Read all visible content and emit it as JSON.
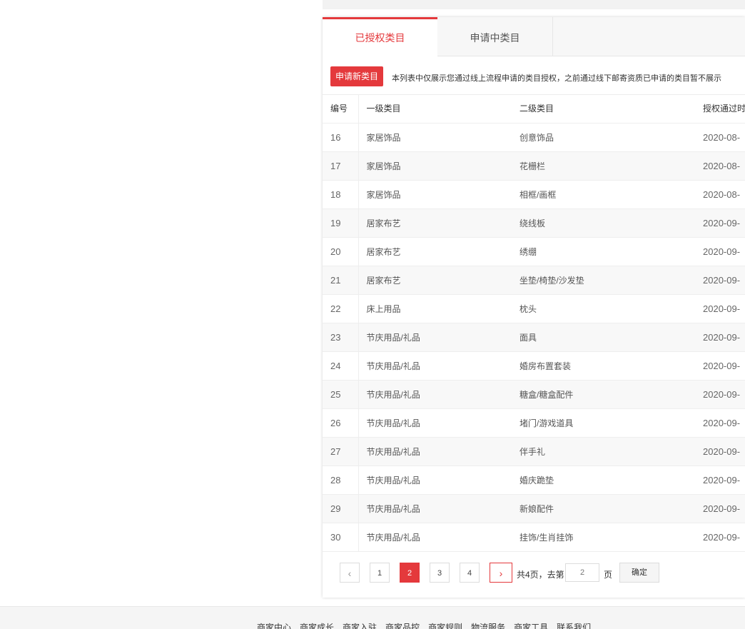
{
  "tabs": [
    {
      "label": "已授权类目",
      "active": true
    },
    {
      "label": "申请中类目",
      "active": false
    }
  ],
  "apply_button": "申请新类目",
  "notice": "本列表中仅展示您通过线上流程申请的类目授权，之前通过线下邮寄资质已申请的类目暂不展示",
  "table": {
    "headers": [
      "编号",
      "一级类目",
      "二级类目",
      "授权通过时间"
    ],
    "rows": [
      [
        "16",
        "家居饰品",
        "创意饰品",
        "2020-08-"
      ],
      [
        "17",
        "家居饰品",
        "花栅栏",
        "2020-08-"
      ],
      [
        "18",
        "家居饰品",
        "相框/画框",
        "2020-08-"
      ],
      [
        "19",
        "居家布艺",
        "绕线板",
        "2020-09-"
      ],
      [
        "20",
        "居家布艺",
        "绣绷",
        "2020-09-"
      ],
      [
        "21",
        "居家布艺",
        "坐垫/椅垫/沙发垫",
        "2020-09-"
      ],
      [
        "22",
        "床上用品",
        "枕头",
        "2020-09-"
      ],
      [
        "23",
        "节庆用品/礼品",
        "面具",
        "2020-09-"
      ],
      [
        "24",
        "节庆用品/礼品",
        "婚房布置套装",
        "2020-09-"
      ],
      [
        "25",
        "节庆用品/礼品",
        "糖盒/糖盒配件",
        "2020-09-"
      ],
      [
        "26",
        "节庆用品/礼品",
        "堵门/游戏道具",
        "2020-09-"
      ],
      [
        "27",
        "节庆用品/礼品",
        "伴手礼",
        "2020-09-"
      ],
      [
        "28",
        "节庆用品/礼品",
        "婚庆跪垫",
        "2020-09-"
      ],
      [
        "29",
        "节庆用品/礼品",
        "新娘配件",
        "2020-09-"
      ],
      [
        "30",
        "节庆用品/礼品",
        "挂饰/生肖挂饰",
        "2020-09-"
      ]
    ]
  },
  "pagination": {
    "prev_icon": "‹",
    "next_icon": "›",
    "pages": [
      "1",
      "2",
      "3",
      "4"
    ],
    "current_page": "2",
    "total_label": "共4页，去第",
    "page_input_value": "2",
    "page_suffix": "页",
    "confirm_label": "确定"
  },
  "footer": {
    "links": [
      "商家中心",
      "商家成长",
      "商家入驻",
      "商家品控",
      "商家规则",
      "物流服务",
      "商家工具",
      "联系我们"
    ]
  },
  "colors": {
    "accent": "#e4393c"
  }
}
